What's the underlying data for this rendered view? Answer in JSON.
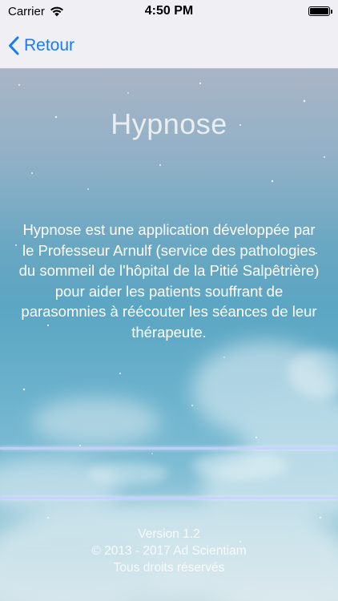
{
  "status_bar": {
    "carrier": "Carrier",
    "time": "4:50 PM"
  },
  "nav": {
    "back_label": "Retour"
  },
  "main": {
    "title": "Hypnose",
    "description": "Hypnose est une application développée par le Professeur Arnulf (service des pathologies du sommeil de l'hôpital de la Pitié Salpêtrière) pour aider les patients souffrant de parasomnies à réécouter les séances de leur thérapeute.",
    "version": "Version 1.2",
    "copyright": "© 2013 - 2017 Ad Scientiam",
    "rights": "Tous droits réservés"
  },
  "colors": {
    "accent": "#1a7cf5",
    "bar_background": "#efeff4"
  }
}
